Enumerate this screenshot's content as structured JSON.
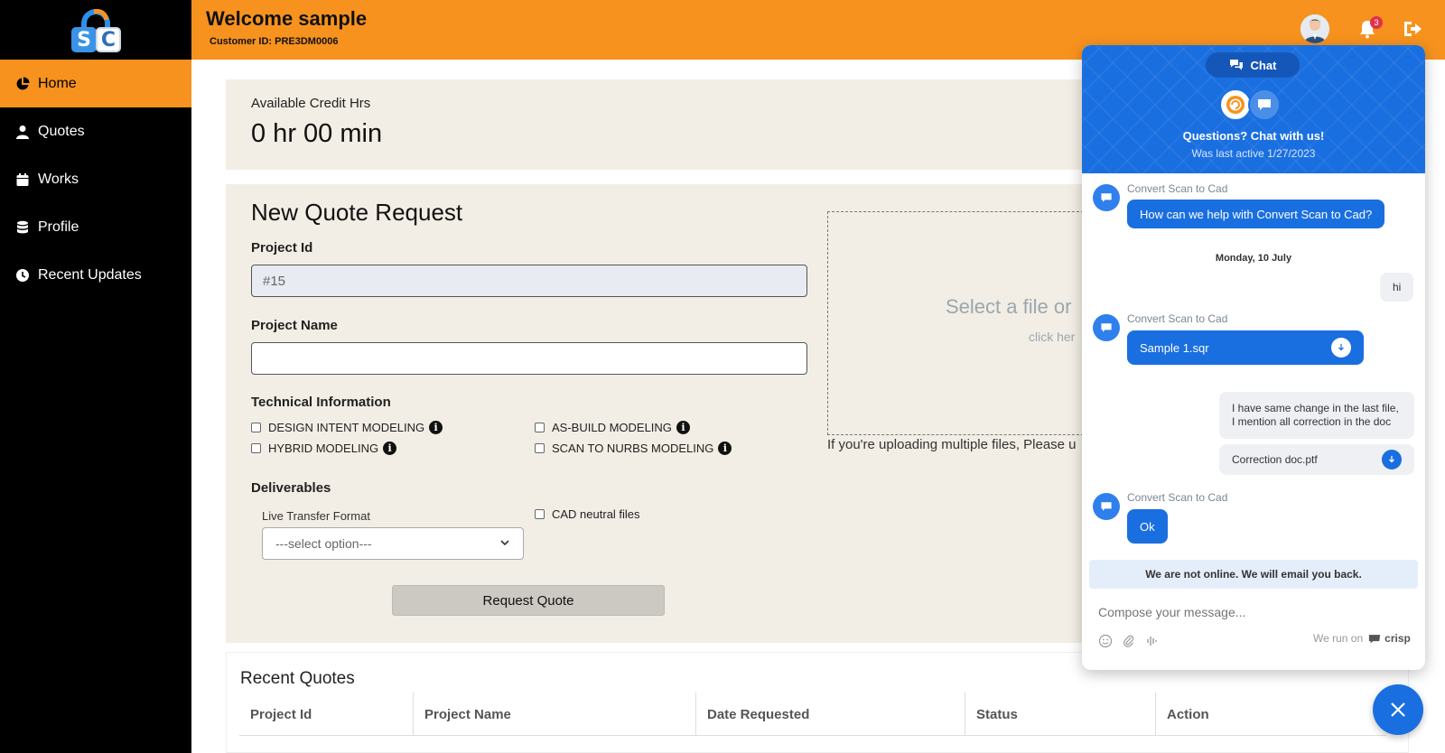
{
  "sidebar": {
    "logo_letters": [
      "S",
      "C"
    ],
    "items": [
      {
        "label": "Home",
        "icon": "pie-chart-icon",
        "active": true
      },
      {
        "label": "Quotes",
        "icon": "user-icon",
        "active": false
      },
      {
        "label": "Works",
        "icon": "calendar-icon",
        "active": false
      },
      {
        "label": "Profile",
        "icon": "database-icon",
        "active": false
      },
      {
        "label": "Recent Updates",
        "icon": "clock-icon",
        "active": false
      }
    ]
  },
  "header": {
    "welcome": "Welcome sample",
    "customer_id": "Customer ID: PRE3DM0006",
    "notification_count": "3"
  },
  "credit": {
    "label": "Available Credit Hrs",
    "value": "0 hr 00 min"
  },
  "quote_form": {
    "title": "New Quote Request",
    "project_id_label": "Project Id",
    "project_id_value": "#15",
    "project_name_label": "Project Name",
    "project_name_value": "",
    "technical_label": "Technical Information",
    "technical_options": [
      "DESIGN INTENT MODELING",
      "AS-BUILD MODELING",
      "HYBRID MODELING",
      "SCAN TO NURBS MODELING"
    ],
    "deliverables_label": "Deliverables",
    "transfer_format_label": "Live Transfer Format",
    "transfer_format_selected": "---select option---",
    "cad_neutral_label": "CAD neutral files",
    "submit_label": "Request Quote",
    "drop_text": "Select a file or",
    "drop_sub": "click her",
    "drop_note": "If you're uploading multiple files, Please u"
  },
  "recent_quotes": {
    "title": "Recent Quotes",
    "columns": [
      "Project Id",
      "Project Name",
      "Date Requested",
      "Status",
      "Action"
    ]
  },
  "chat": {
    "pill_label": "Chat",
    "headline": "Questions? Chat with us!",
    "last_active": "Was last active 1/27/2023",
    "bot_name": "Convert Scan to Cad",
    "msg_greeting": "How can we help with Convert Scan to Cad?",
    "date_label": "Monday, 10 July",
    "msg_user_hi": "hi",
    "msg_file_bot": "Sample 1.sqr",
    "msg_user_text_line1": "I have same change in the last file,",
    "msg_user_text_line2": "I mention all correction in the doc",
    "msg_file_user": "Correction doc.ptf",
    "msg_ok": "Ok",
    "offline_notice": "We are not online. We will email you back.",
    "compose_placeholder": "Compose your message...",
    "powered_by": "We run on",
    "powered_brand": "crisp"
  },
  "colors": {
    "accent_orange": "#f7921e",
    "chat_blue": "#1a6fe0",
    "card_beige": "#f2eee5"
  }
}
